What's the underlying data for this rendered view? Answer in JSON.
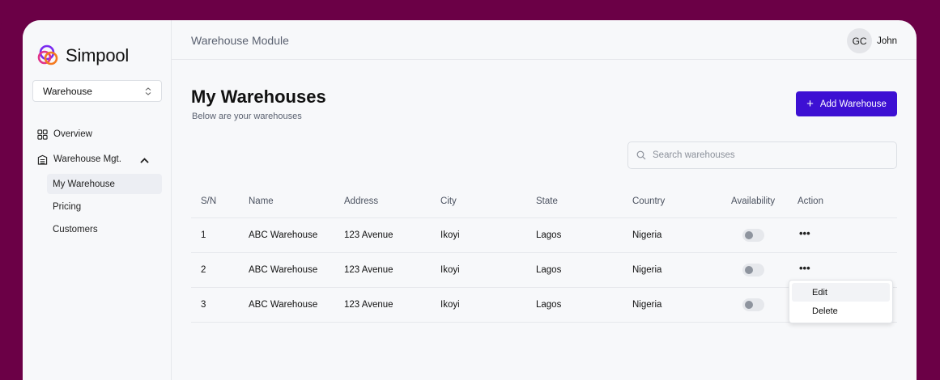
{
  "app": {
    "brand": "Simpool"
  },
  "sidebar": {
    "select_value": "Warehouse",
    "items": [
      {
        "label": "Overview",
        "icon": "grid-icon"
      },
      {
        "label": "Warehouse Mgt.",
        "icon": "building-icon",
        "expanded": true
      }
    ],
    "subitems": [
      {
        "label": "My Warehouse",
        "active": true
      },
      {
        "label": "Pricing"
      },
      {
        "label": "Customers"
      }
    ]
  },
  "header": {
    "module_title": "Warehouse Module",
    "avatar_initials": "GC",
    "user_name": "John"
  },
  "main": {
    "title": "My Warehouses",
    "subtitle": "Below are your warehouses",
    "add_button": "Add Warehouse",
    "search_placeholder": "Search warehouses"
  },
  "table": {
    "columns": [
      "S/N",
      "Name",
      "Address",
      "City",
      "State",
      "Country",
      "Availability",
      "Action"
    ],
    "rows": [
      {
        "sn": "1",
        "name": "ABC Warehouse",
        "address": "123 Avenue",
        "city": "Ikoyi",
        "state": "Lagos",
        "country": "Nigeria",
        "available": false
      },
      {
        "sn": "2",
        "name": "ABC Warehouse",
        "address": "123 Avenue",
        "city": "Ikoyi",
        "state": "Lagos",
        "country": "Nigeria",
        "available": false
      },
      {
        "sn": "3",
        "name": "ABC Warehouse",
        "address": "123 Avenue",
        "city": "Ikoyi",
        "state": "Lagos",
        "country": "Nigeria",
        "available": false
      }
    ],
    "action_glyph": "•••"
  },
  "action_menu": {
    "items": [
      "Edit",
      "Delete"
    ]
  },
  "colors": {
    "frame": "#6b0046",
    "primary": "#3d10d3",
    "logo_purple": "#7b2cf0",
    "logo_pink": "#e0338a",
    "logo_orange": "#f47a20"
  }
}
